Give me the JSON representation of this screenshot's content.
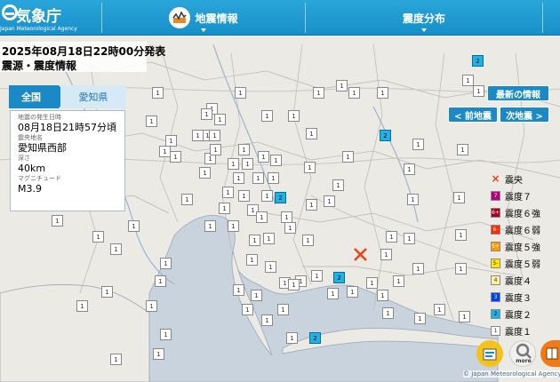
{
  "header": {
    "logo_text": "気象庁",
    "logo_subtitle": "Japan Meteorological Agency",
    "menu": [
      {
        "label": "地震情報",
        "icon": "earthquake-info-icon"
      },
      {
        "label": "震度分布"
      }
    ]
  },
  "issue": {
    "datetime": "2025年08月18日22時00分発表",
    "title": "震源・震度情報"
  },
  "tabs": {
    "all": "全国",
    "prefecture": "愛知県"
  },
  "info": {
    "occurrence_label": "地震の発生日時",
    "occurrence_value": "08月18日21時57分頃",
    "epicenter_label": "震央地名",
    "epicenter_value": "愛知県西部",
    "depth_label": "深さ",
    "depth_value": "40km",
    "magnitude_label": "マグニチュード",
    "magnitude_value": "M3.9"
  },
  "buttons": {
    "latest": "最新の情報",
    "prev": "< 前地震",
    "next": "次地震 >",
    "more": "more"
  },
  "legend": [
    {
      "label": "震央",
      "swatch": "×",
      "color": "#e8421b"
    },
    {
      "label": "震度７",
      "swatch": "7",
      "color": "#b4007e"
    },
    {
      "label": "震度６強",
      "swatch": "6+",
      "color": "#a50021"
    },
    {
      "label": "震度６弱",
      "swatch": "6-",
      "color": "#ff2800"
    },
    {
      "label": "震度５強",
      "swatch": "5+",
      "color": "#ff9900"
    },
    {
      "label": "震度５弱",
      "swatch": "5-",
      "color": "#ffe600"
    },
    {
      "label": "震度４",
      "swatch": "4",
      "color": "#fff0a0"
    },
    {
      "label": "震度３",
      "swatch": "3",
      "color": "#0041ff"
    },
    {
      "label": "震度２",
      "swatch": "2",
      "color": "#1fb2e6"
    },
    {
      "label": "震度１",
      "swatch": "1",
      "color": "#ffffff"
    }
  ],
  "copyright": "© Japan Meteorological Agency",
  "intensity_markers_label": "1",
  "intensity2_label": "2"
}
